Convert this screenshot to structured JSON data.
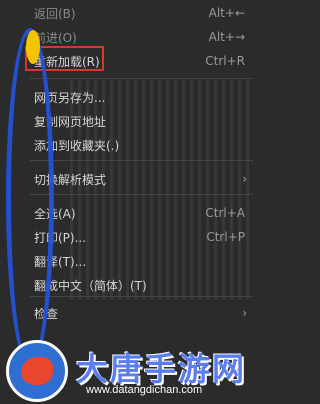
{
  "menu": {
    "items": [
      {
        "label": "返回(B)",
        "shortcut": "Alt+←",
        "dim": true
      },
      {
        "label": "前进(O)",
        "shortcut": "Alt+→",
        "dim": true
      },
      {
        "label": "重新加载(R)",
        "shortcut": "Ctrl+R",
        "dim": false
      },
      {
        "label": "网页另存为...",
        "shortcut": "",
        "dim": false
      },
      {
        "label": "复制网页地址",
        "shortcut": "",
        "dim": false
      },
      {
        "label": "添加到收藏夹(.)",
        "shortcut": "",
        "dim": false
      },
      {
        "label": "切换解析模式",
        "shortcut": "",
        "arrow": "›",
        "dim": false
      },
      {
        "label": "全选(A)",
        "shortcut": "Ctrl+A",
        "dim": false
      },
      {
        "label": "打印(P)...",
        "shortcut": "Ctrl+P",
        "dim": false
      },
      {
        "label": "翻译(T)...",
        "shortcut": "",
        "dim": false
      },
      {
        "label": "翻成中文（简体）(T)",
        "shortcut": "",
        "dim": false
      },
      {
        "label": "检查",
        "shortcut": "",
        "arrow": "›",
        "dim": false
      }
    ]
  },
  "watermark": {
    "title": "大唐手游网",
    "url": "www.datangdichan.com"
  },
  "colors": {
    "menu_bg": "#2b2b2b",
    "highlight_border": "#d23b2b",
    "oval": "#2452d6"
  }
}
